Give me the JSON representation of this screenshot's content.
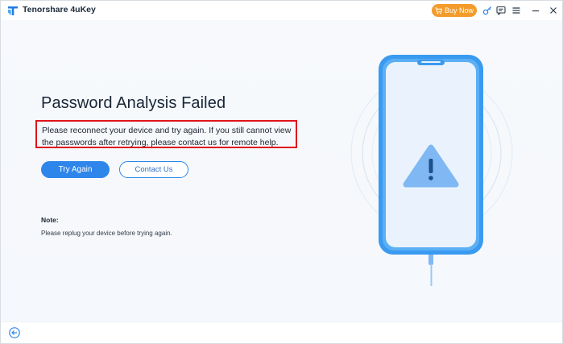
{
  "app": {
    "name": "Tenorshare 4uKey",
    "logo_icon": "tenorshare-logo-icon"
  },
  "titlebar": {
    "buy_label": "Buy Now",
    "buy_icon": "cart-icon",
    "icons": [
      "key-icon",
      "feedback-icon",
      "menu-icon",
      "minimize-icon",
      "close-icon"
    ]
  },
  "main": {
    "headline": "Password Analysis Failed",
    "message": "Please reconnect your device and try again. If you still cannot view the passwords after retrying, please contact us for remote help.",
    "try_again_label": "Try Again",
    "contact_label": "Contact Us",
    "note_title": "Note:",
    "note_text": "Please replug your device before trying again."
  },
  "illustration": {
    "icon": "warning-phone-icon"
  },
  "footer": {
    "back_icon": "back-arrow-icon"
  },
  "colors": {
    "accent": "#2f86ea",
    "buy": "#f39c2b",
    "highlight_border": "#e0141b",
    "phone": "#3a9af0",
    "screen": "#e9f2fc"
  }
}
